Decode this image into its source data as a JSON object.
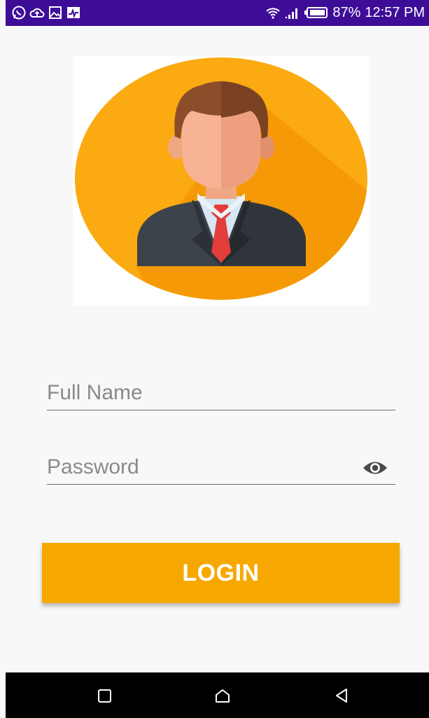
{
  "status_bar": {
    "notification_icons": [
      "whatsapp-icon",
      "cloud-upload-icon",
      "image-icon",
      "activity-icon"
    ],
    "battery": "87%",
    "time": "12:57 PM",
    "background_color": "#3e0d98"
  },
  "form": {
    "fullname_placeholder": "Full Name",
    "password_placeholder": "Password",
    "login_label": "LOGIN"
  },
  "colors": {
    "accent": "#f6a800",
    "avatar_circle": "#fbaa12"
  },
  "navigation": {
    "buttons": [
      "recent-apps-icon",
      "home-icon",
      "back-icon"
    ]
  }
}
